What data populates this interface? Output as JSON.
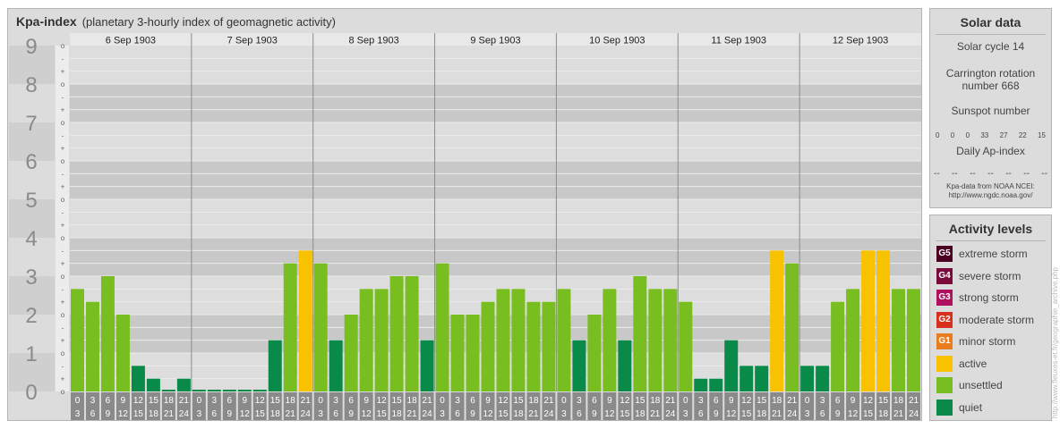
{
  "header": {
    "title": "Kpa-index",
    "subtitle": "(planetary 3-hourly index of geomagnetic activity)"
  },
  "chart_data": {
    "type": "bar",
    "title": "Kpa-index",
    "subtitle": "(planetary 3-hourly index of geomagnetic activity)",
    "ylim": [
      0,
      9
    ],
    "y_major_ticks": [
      "0",
      "1",
      "2",
      "3",
      "4",
      "5",
      "6",
      "7",
      "8",
      "9"
    ],
    "y_minor_tick_labels": [
      "o",
      "+",
      "-"
    ],
    "days": [
      "6 Sep 1903",
      "7 Sep 1903",
      "8 Sep 1903",
      "9 Sep 1903",
      "10 Sep 1903",
      "11 Sep 1903",
      "12 Sep 1903"
    ],
    "interval_start_labels": [
      "0",
      "3",
      "6",
      "9",
      "12",
      "15",
      "18",
      "21"
    ],
    "interval_end_labels": [
      "3",
      "6",
      "9",
      "12",
      "15",
      "18",
      "21",
      "24"
    ],
    "values": [
      [
        2.667,
        2.333,
        3.0,
        2.0,
        0.667,
        0.333,
        0.0,
        0.333
      ],
      [
        0.0,
        0.0,
        0.0,
        0.0,
        0.0,
        1.333,
        3.333,
        3.667
      ],
      [
        3.333,
        1.333,
        2.0,
        2.667,
        2.667,
        3.0,
        3.0,
        1.333
      ],
      [
        3.333,
        2.0,
        2.0,
        2.333,
        2.667,
        2.667,
        2.333,
        2.333
      ],
      [
        2.667,
        1.333,
        2.0,
        2.667,
        1.333,
        3.0,
        2.667,
        2.667
      ],
      [
        2.333,
        0.333,
        0.333,
        1.333,
        0.667,
        0.667,
        3.667,
        3.333
      ],
      [
        0.667,
        0.667,
        2.333,
        2.667,
        3.667,
        3.667,
        2.667,
        2.667
      ]
    ],
    "grid": true
  },
  "solar": {
    "title": "Solar data",
    "cycle": "Solar cycle 14",
    "carrington_line1": "Carrington rotation",
    "carrington_line2": "number 668",
    "sunspot_label": "Sunspot number",
    "sunspots": [
      "0",
      "0",
      "0",
      "33",
      "27",
      "22",
      "15"
    ],
    "ap_label": "Daily Ap-index",
    "ap_values": [
      "--",
      "--",
      "--",
      "--",
      "--",
      "--",
      "--"
    ],
    "credit_line1": "Kpa-data from NOAA NCEI:",
    "credit_line2": "http://www.ngdc.noaa.gov/"
  },
  "activity": {
    "title": "Activity levels",
    "levels": [
      {
        "code": "G5",
        "label": "extreme storm",
        "color": "#4a0020"
      },
      {
        "code": "G4",
        "label": "severe storm",
        "color": "#7a0a3a"
      },
      {
        "code": "G3",
        "label": "strong storm",
        "color": "#b0105e"
      },
      {
        "code": "G2",
        "label": "moderate storm",
        "color": "#d8301e"
      },
      {
        "code": "G1",
        "label": "minor storm",
        "color": "#e87c1e"
      },
      {
        "code": "",
        "label": "active",
        "color": "#f8c200"
      },
      {
        "code": "",
        "label": "unsettled",
        "color": "#78be20"
      },
      {
        "code": "",
        "label": "quiet",
        "color": "#0a8a48"
      }
    ]
  },
  "watermark": "http://www.fleuxes-et.fr/geographie_archive.php"
}
